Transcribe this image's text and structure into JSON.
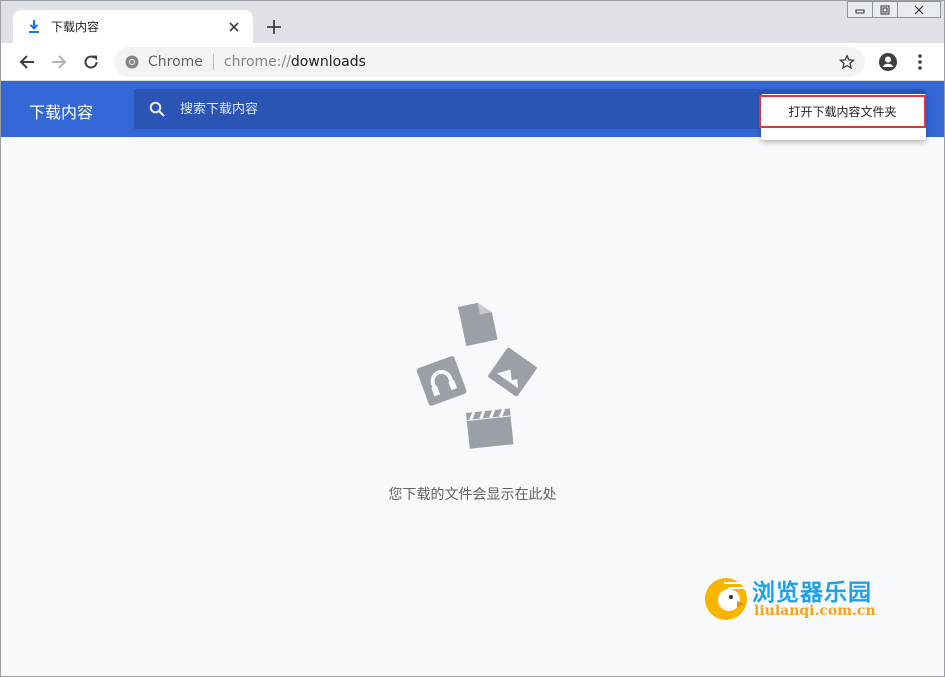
{
  "window": {
    "controls": [
      "minimize-icon",
      "restore-icon",
      "close-icon"
    ]
  },
  "tab": {
    "title": "下载内容",
    "icon": "download-icon"
  },
  "toolbar": {
    "site_label": "Chrome",
    "url_scheme": "chrome://",
    "url_path": "downloads"
  },
  "downloads": {
    "title": "下载内容",
    "search_placeholder": "搜索下载内容",
    "menu_item": "打开下载内容文件夹",
    "empty_message": "您下载的文件会显示在此处",
    "accent_color": "#3367d6",
    "highlight_color": "#e0333a"
  },
  "watermark": {
    "title": "浏览器乐园",
    "url": "liulanqi.com.cn"
  }
}
